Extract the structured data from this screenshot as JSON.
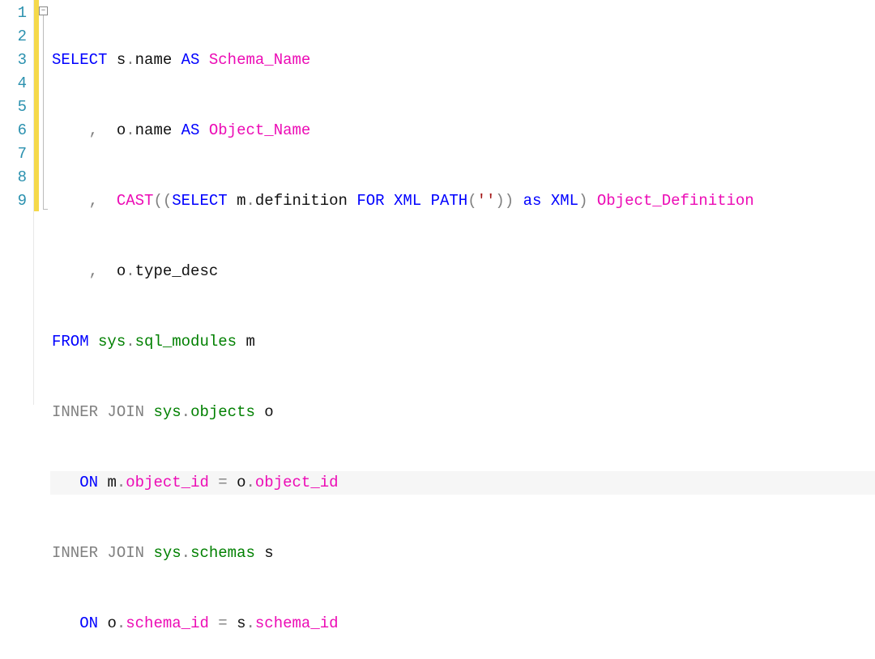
{
  "editor": {
    "line_numbers": [
      "1",
      "2",
      "3",
      "4",
      "5",
      "6",
      "7",
      "8",
      "9"
    ],
    "changed_lines": [
      1,
      2,
      3,
      4,
      5,
      6,
      7,
      8,
      9
    ],
    "current_line": 7,
    "fold_symbol": "−",
    "code": {
      "l1": {
        "kw_select": "SELECT",
        "s": "s",
        "name": "name",
        "as": "AS",
        "alias": "Schema_Name"
      },
      "l2": {
        "comma": ",",
        "o": "o",
        "name": "name",
        "as": "AS",
        "alias": "Object_Name"
      },
      "l3": {
        "comma": ",",
        "cast": "CAST",
        "select": "SELECT",
        "m": "m",
        "def": "definition",
        "for": "FOR",
        "xml": "XML",
        "path": "PATH",
        "str": "''",
        "as": "as",
        "xmltype": "XML",
        "alias": "Object_Definition"
      },
      "l4": {
        "comma": ",",
        "o": "o",
        "td": "type_desc"
      },
      "l5": {
        "from": "FROM",
        "sys": "sys",
        "sqlm": "sql_modules",
        "m": "m"
      },
      "l6": {
        "inner": "INNER",
        "join": "JOIN",
        "sys": "sys",
        "obj": "objects",
        "o": "o"
      },
      "l7": {
        "on": "ON",
        "m": "m",
        "oid": "object_id",
        "eq": "=",
        "o": "o",
        "oid2": "object_id"
      },
      "l8": {
        "inner": "INNER",
        "join": "JOIN",
        "sys": "sys",
        "sch": "schemas",
        "s": "s"
      },
      "l9": {
        "on": "ON",
        "o": "o",
        "sid": "schema_id",
        "eq": "=",
        "s": "s",
        "sid2": "schema_id"
      }
    }
  }
}
